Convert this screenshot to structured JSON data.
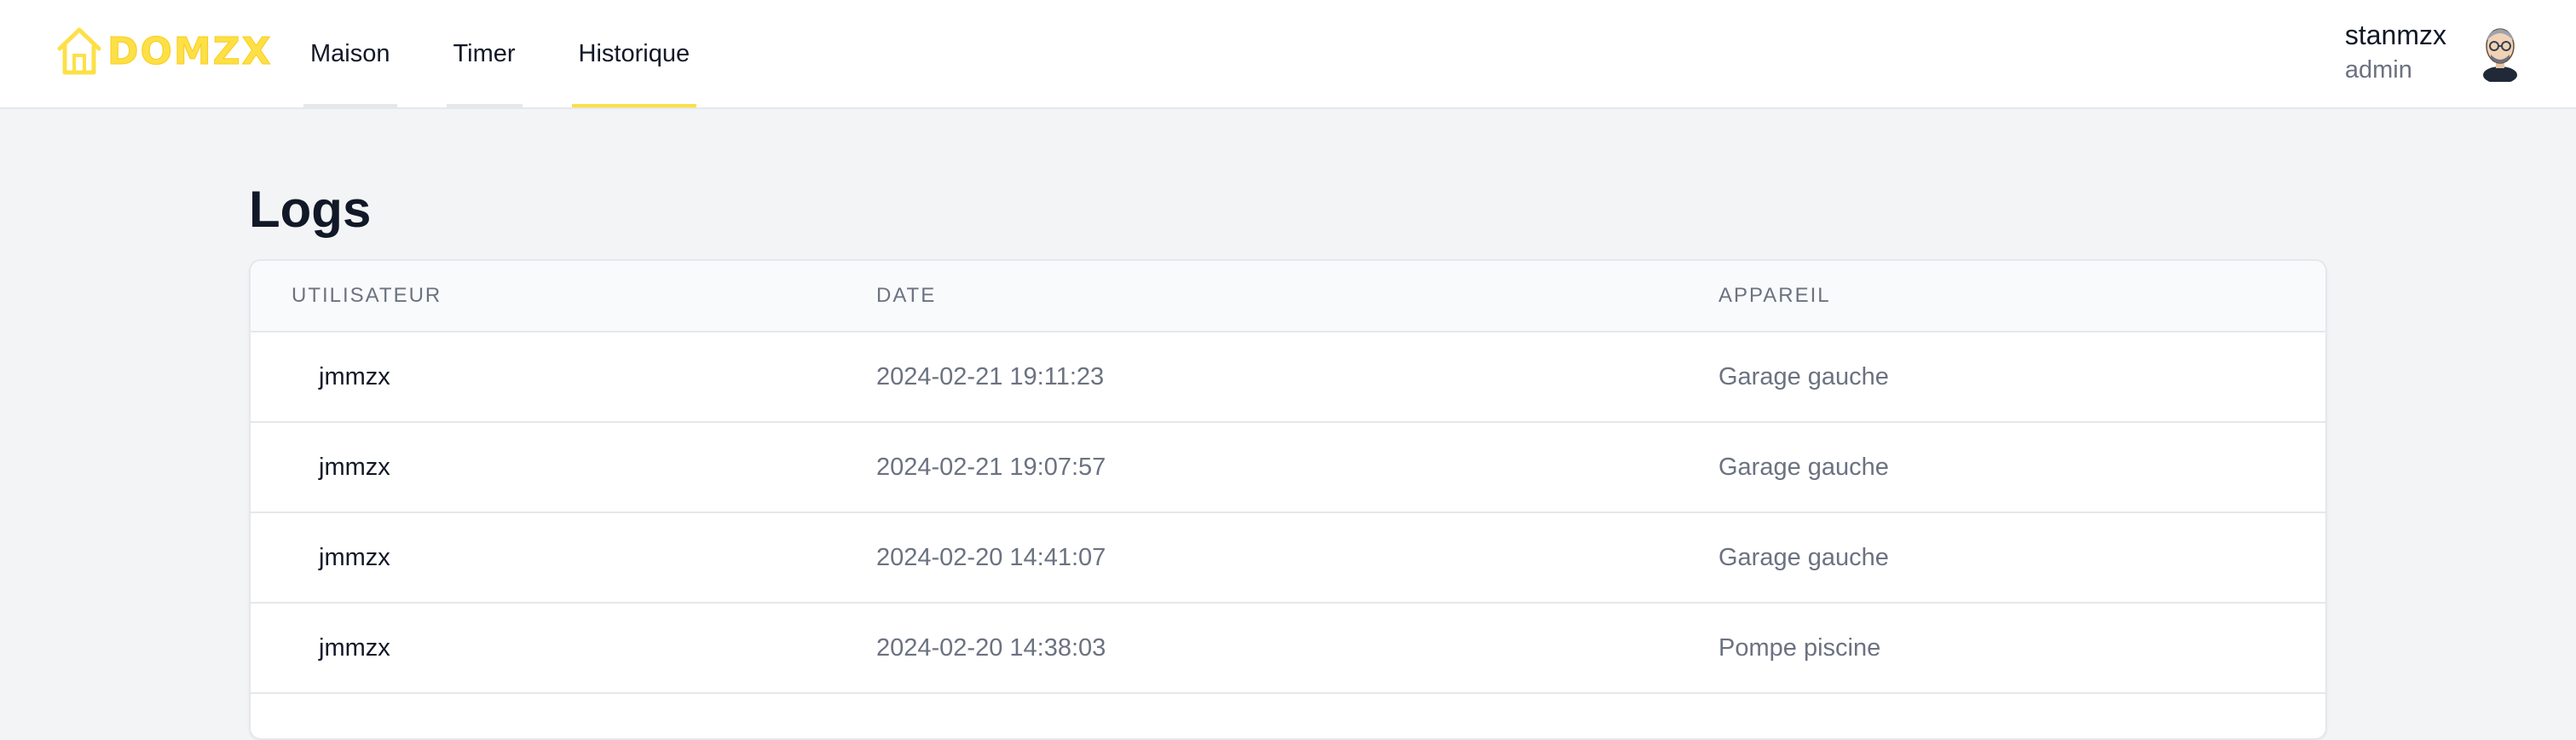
{
  "brand": {
    "name": "DOMZX",
    "color": "#fde047"
  },
  "nav": {
    "tabs": [
      {
        "label": "Maison",
        "active": false
      },
      {
        "label": "Timer",
        "active": false
      },
      {
        "label": "Historique",
        "active": true
      }
    ]
  },
  "user": {
    "name": "stanmzx",
    "role": "admin"
  },
  "page": {
    "title": "Logs"
  },
  "table": {
    "headers": [
      "UTILISATEUR",
      "DATE",
      "APPAREIL"
    ],
    "rows": [
      {
        "user": "jmmzx",
        "date": "2024-02-21 19:11:23",
        "device": "Garage gauche"
      },
      {
        "user": "jmmzx",
        "date": "2024-02-21 19:07:57",
        "device": "Garage gauche"
      },
      {
        "user": "jmmzx",
        "date": "2024-02-20 14:41:07",
        "device": "Garage gauche"
      },
      {
        "user": "jmmzx",
        "date": "2024-02-20 14:38:03",
        "device": "Pompe piscine"
      }
    ]
  },
  "icons": {
    "logo": "house-icon",
    "avatar": "user-avatar"
  }
}
